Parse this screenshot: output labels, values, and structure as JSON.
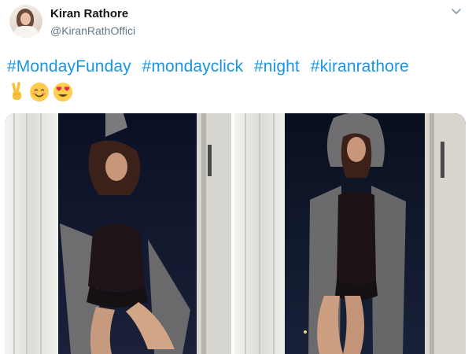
{
  "user": {
    "display_name": "Kiran Rathore",
    "handle": "@KiranRathOffici"
  },
  "tweet": {
    "hashtags": [
      "#MondayFunday",
      "#mondayclick",
      "#night",
      "#kiranrathore"
    ],
    "emojis": [
      "victory-hand",
      "smiling-face-with-smiling-eyes",
      "smiling-face-with-heart-eyes"
    ]
  },
  "media": {
    "photo_count": 2
  },
  "colors": {
    "link": "#1b95e0",
    "name": "#14171a",
    "secondary": "#657786"
  }
}
